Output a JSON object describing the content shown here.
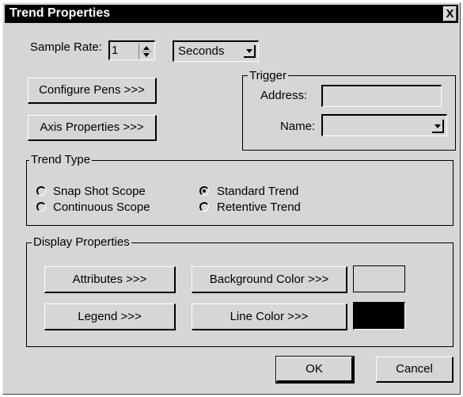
{
  "window": {
    "title": "Trend Properties",
    "close_glyph": "X"
  },
  "sample_rate": {
    "label": "Sample Rate:",
    "value": "1",
    "unit": "Seconds"
  },
  "buttons": {
    "configure_pens": "Configure Pens >>>",
    "axis_properties": "Axis Properties >>>",
    "ok": "OK",
    "cancel": "Cancel"
  },
  "trigger": {
    "title": "Trigger",
    "address_label": "Address:",
    "address_value": "",
    "name_label": "Name:",
    "name_value": ""
  },
  "trend_type": {
    "title": "Trend Type",
    "options": [
      {
        "label": "Snap Shot Scope",
        "selected": false
      },
      {
        "label": "Continuous Scope",
        "selected": false
      },
      {
        "label": "Standard Trend",
        "selected": true
      },
      {
        "label": "Retentive Trend",
        "selected": false
      }
    ]
  },
  "display_properties": {
    "title": "Display Properties",
    "attributes": "Attributes >>>",
    "legend": "Legend >>>",
    "background_color": "Background Color >>>",
    "line_color": "Line Color >>>",
    "background_swatch": "#d6d6d6",
    "line_swatch": "#000000"
  },
  "colors": {
    "face": "#d6d6d6",
    "title_bar": "#000000"
  }
}
